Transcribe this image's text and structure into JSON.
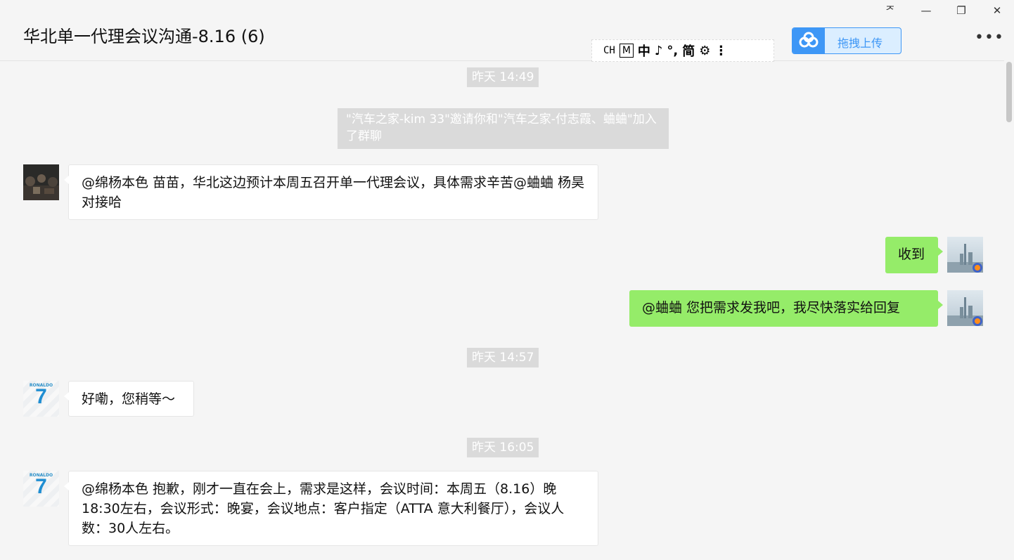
{
  "window": {
    "title": "华北单一代理会议沟通-8.16 (6)",
    "controls": {
      "pin": "ᅎ",
      "minimize": "—",
      "restore": "❐",
      "close": "✕"
    },
    "more": "•••"
  },
  "ime": {
    "ch": "CH",
    "m": "M",
    "zh": "中",
    "moon": "♪",
    "punct": "°,",
    "jian": "简",
    "gear": "⚙",
    "more": "⋮"
  },
  "upload": {
    "label": "拖拽上传",
    "icon": "cloud-icon",
    "accent": "#3e97f6"
  },
  "chat": {
    "timestamps": [
      "昨天 14:49",
      "昨天 14:57",
      "昨天 16:05"
    ],
    "system_notice": "\"汽车之家-kim 33\"邀请你和\"汽车之家-付志霞、蛐蛐\"加入了群聊",
    "messages": [
      {
        "side": "left",
        "avatar": "photo-avatar",
        "text": "@绵杨本色 苗苗，华北这边预计本周五召开单一代理会议，具体需求辛苦@蛐蛐 杨昊对接哈"
      },
      {
        "side": "right",
        "avatar": "city-skyline-avatar",
        "text": "收到"
      },
      {
        "side": "right",
        "avatar": "city-skyline-avatar",
        "text": "@蛐蛐 您把需求发我吧，我尽快落实给回复"
      },
      {
        "side": "left",
        "avatar": "ronaldo-jersey-avatar",
        "avatar_label": "RONALDO",
        "avatar_number": "7",
        "text": "好嘞，您稍等～"
      },
      {
        "side": "left",
        "avatar": "ronaldo-jersey-avatar",
        "avatar_label": "RONALDO",
        "avatar_number": "7",
        "text": "@绵杨本色 抱歉，刚才一直在会上，需求是这样，会议时间：本周五（8.16）晚18:30左右，会议形式：晚宴，会议地点：客户指定（ATTA 意大利餐厅），会议人数：30人左右。"
      }
    ]
  },
  "colors": {
    "background": "#f5f5f5",
    "self_bubble": "#95ec69",
    "other_bubble": "#ffffff",
    "timestamp_bg": "#dadada"
  }
}
